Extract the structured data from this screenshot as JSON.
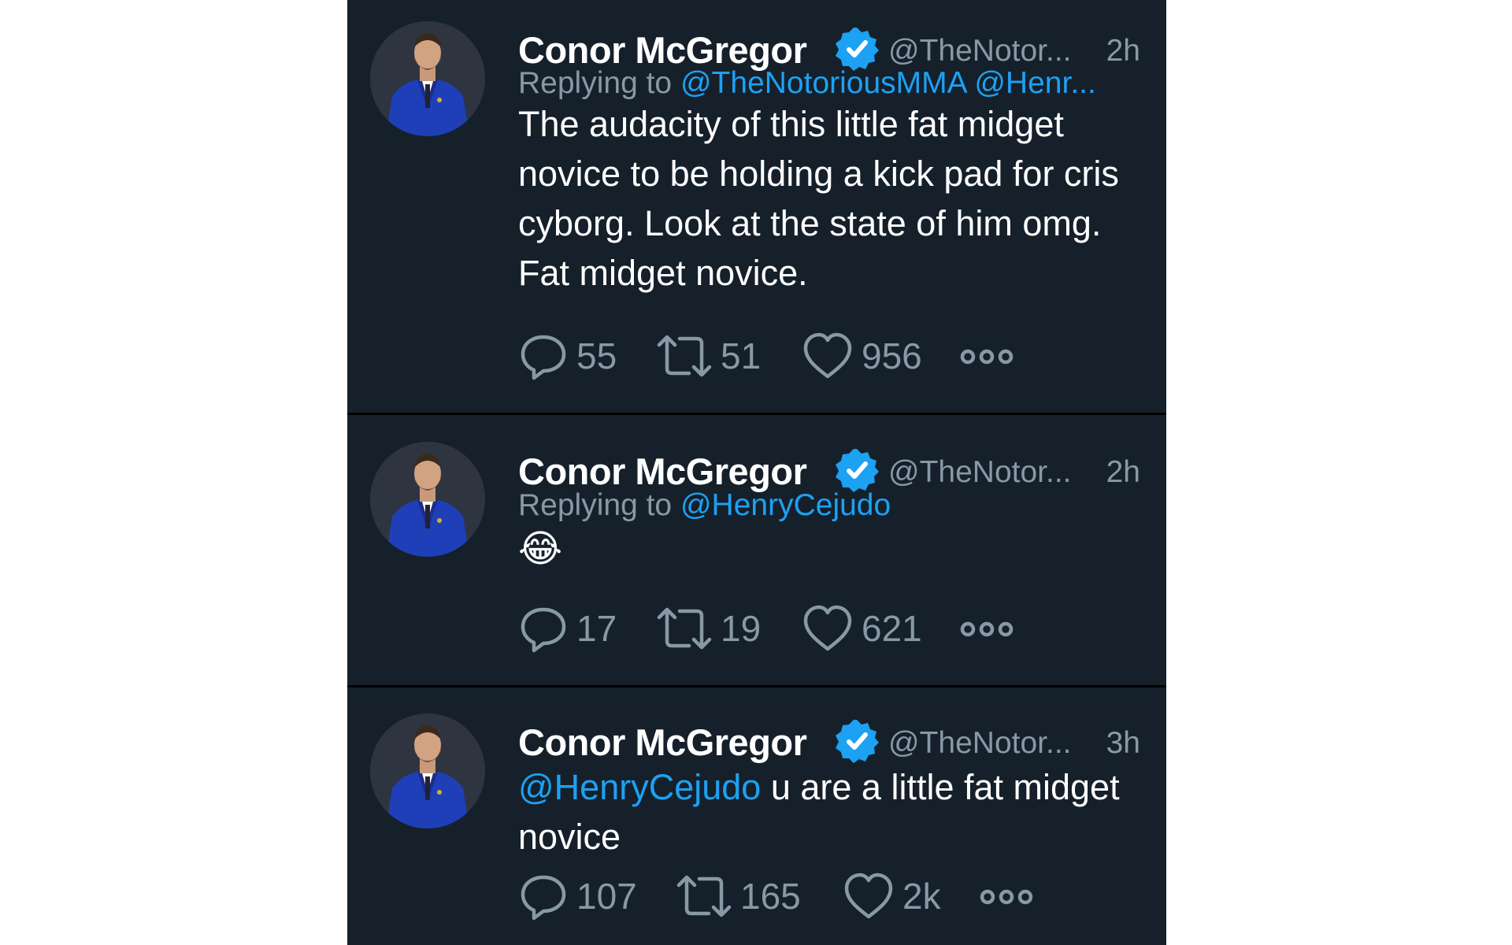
{
  "colors": {
    "background": "#15202b",
    "text": "#ffffff",
    "muted": "#8899a6",
    "link": "#1da1f2",
    "verified": "#1da1f2"
  },
  "tweets": [
    {
      "name": "Conor McGregor",
      "handle": "@TheNotor...",
      "time": "2h",
      "replying_prefix": "Replying to",
      "replying_mentions": "@TheNotoriousMMA @Henr...",
      "text": "The audacity of this little fat midget novice to be holding a kick pad for cris cyborg. Look at the state of him omg. Fat midget novice.",
      "replies": "55",
      "retweets": "51",
      "likes": "956",
      "icons": [
        "reply-icon",
        "retweet-icon",
        "like-icon",
        "more-icon"
      ]
    },
    {
      "name": "Conor McGregor",
      "handle": "@TheNotor...",
      "time": "2h",
      "replying_prefix": "Replying to",
      "replying_mentions": "@HenryCejudo",
      "text": "😂",
      "replies": "17",
      "retweets": "19",
      "likes": "621"
    },
    {
      "name": "Conor McGregor",
      "handle": "@TheNotor...",
      "time": "3h",
      "text_mention": "@HenryCejudo",
      "text": "u are a little fat midget novice",
      "replies": "107",
      "retweets": "165",
      "likes": "2k"
    }
  ]
}
